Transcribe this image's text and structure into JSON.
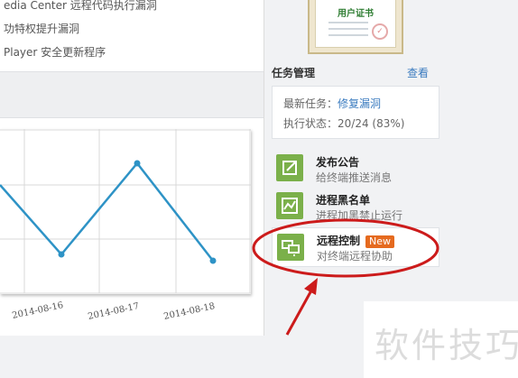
{
  "news": {
    "items": [
      "edia Center 远程代码执行漏洞",
      "功特权提升漏洞",
      "Player 安全更新程序"
    ]
  },
  "certificate": {
    "title": "用户证书"
  },
  "task_management": {
    "title": "任务管理",
    "view_link": "查看",
    "latest_label": "最新任务：",
    "latest_value": "修复漏洞",
    "status_label": "执行状态：",
    "status_value": "20/24 (83%)"
  },
  "actions": [
    {
      "name": "发布公告",
      "desc": "给终端推送消息",
      "icon": "edit-icon"
    },
    {
      "name": "进程黑名单",
      "desc": "进程加黑禁止运行",
      "icon": "chart-blacklist-icon"
    },
    {
      "name": "远程控制",
      "desc": "对终端远程协助",
      "icon": "monitor-icon",
      "badge": "New"
    }
  ],
  "chart_data": {
    "type": "line",
    "x": [
      "2014-08-16",
      "2014-08-17",
      "2014-08-18"
    ],
    "series": [
      {
        "values": [
          null,
          null,
          null
        ]
      }
    ],
    "grid": true,
    "line_color": "#2e93c6"
  },
  "watermark": "软件技巧",
  "colors": {
    "accent_link": "#3a7bbf",
    "icon_green": "#7bb04a",
    "badge_orange": "#e56a1f",
    "annotation_red": "#cc1b1b"
  }
}
